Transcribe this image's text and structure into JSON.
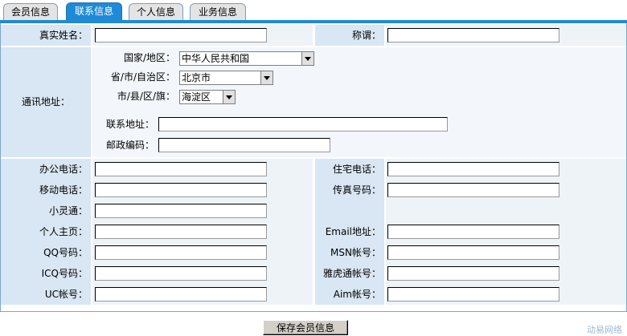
{
  "tabs": [
    "会员信息",
    "联系信息",
    "个人信息",
    "业务信息"
  ],
  "form": {
    "real_name_label": "真实姓名：",
    "title_label": "称谓：",
    "address_label": "通讯地址：",
    "country_label": "国家/地区：",
    "country_value": "中华人民共和国",
    "province_label": "省/市/自治区：",
    "province_value": "北京市",
    "district_label": "市/县/区/旗：",
    "district_value": "海淀区",
    "contact_address_label": "联系地址：",
    "postcode_label": "邮政编码：",
    "office_phone_label": "办公电话：",
    "home_phone_label": "住宅电话：",
    "mobile_label": "移动电话：",
    "fax_label": "传真号码：",
    "phs_label": "小灵通：",
    "homepage_label": "个人主页：",
    "email_label": "Email地址：",
    "qq_label": "QQ号码：",
    "msn_label": "MSN帐号：",
    "icq_label": "ICQ号码：",
    "yahoo_label": "雅虎通帐号：",
    "uc_label": "UC帐号：",
    "aim_label": "Aim帐号："
  },
  "save_button": "保存会员信息",
  "watermark": "动易网络",
  "colors": {
    "tab_active": "#1f8ad8",
    "label_bg": "#d9e6f3",
    "border": "#7aa6d1"
  }
}
